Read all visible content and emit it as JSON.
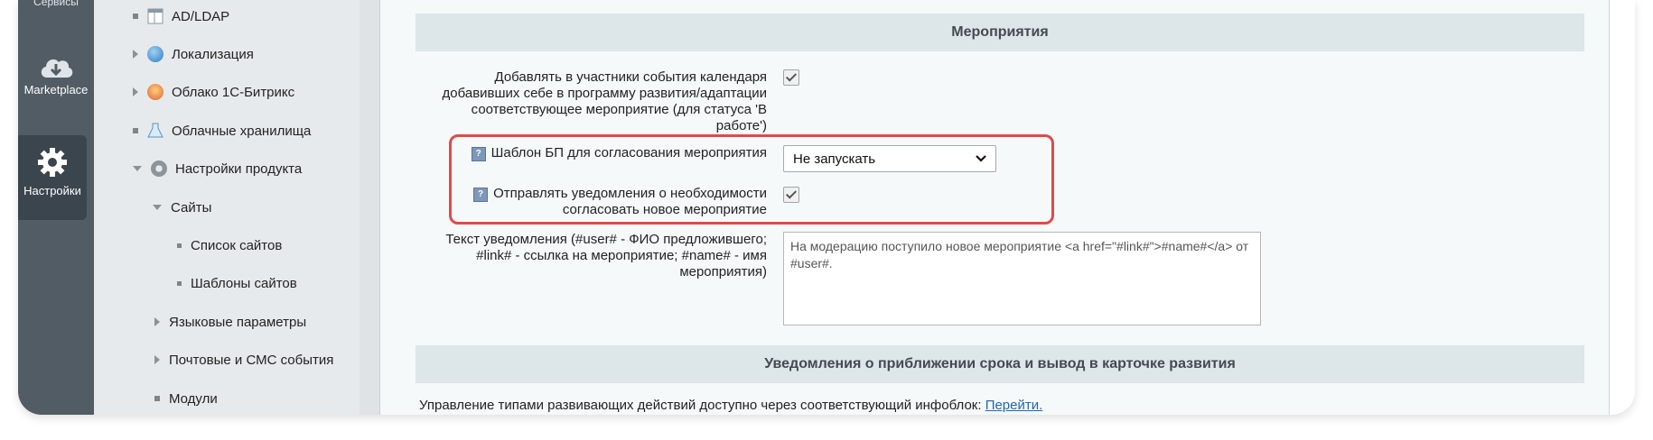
{
  "dock": {
    "top_label": "Сервисы",
    "items": [
      {
        "label": "Marketplace",
        "icon": "cloud-download-icon"
      },
      {
        "label": "Настройки",
        "icon": "gear-icon"
      }
    ]
  },
  "tree": [
    {
      "label": "AD/LDAP",
      "marker": "bullet",
      "icon": "table-icon"
    },
    {
      "label": "Локализация",
      "marker": "arrow",
      "icon": "globe-icon"
    },
    {
      "label": "Облако 1С-Битрикс",
      "marker": "arrow",
      "icon": "cloud-icon"
    },
    {
      "label": "Облачные хранилища",
      "marker": "bullet",
      "icon": "flask-icon"
    },
    {
      "label": "Настройки продукта",
      "marker": "arrow-down",
      "icon": "gear-icon"
    },
    {
      "label": "Сайты",
      "marker": "arrow-down"
    },
    {
      "label": "Список сайтов",
      "marker": "bullet"
    },
    {
      "label": "Шаблоны сайтов",
      "marker": "bullet"
    },
    {
      "label": "Языковые параметры",
      "marker": "arrow"
    },
    {
      "label": "Почтовые и СМС события",
      "marker": "arrow"
    },
    {
      "label": "Модули",
      "marker": "bullet"
    }
  ],
  "main": {
    "section1_title": "Мероприятия",
    "opt1_label": "Добавлять в участники события календаря добавивших себе в программу развития/адаптации соответствующее мероприятие (для статуса 'В работе')",
    "opt1_checked": true,
    "opt2_label": "Шаблон БП для согласования мероприятия",
    "opt2_select_value": "Не запускать",
    "opt3_label": "Отправлять уведомления о необходимости согласовать новое мероприятие",
    "opt3_checked": true,
    "opt4_label": "Текст уведомления (#user# - ФИО предложившего; #link# - ссылка на мероприятие; #name# - имя мероприятия)",
    "opt4_value": "На модерацию поступило новое мероприятие <a href=\"#link#\">#name#</a> от #user#.",
    "section2_title": "Уведомления о приближении срока и вывод в карточке развития",
    "note_text": "Управление типами развивающих действий доступно через соответствующий инфоблок:",
    "note_link": "Перейти.",
    "help_glyph": "?"
  }
}
